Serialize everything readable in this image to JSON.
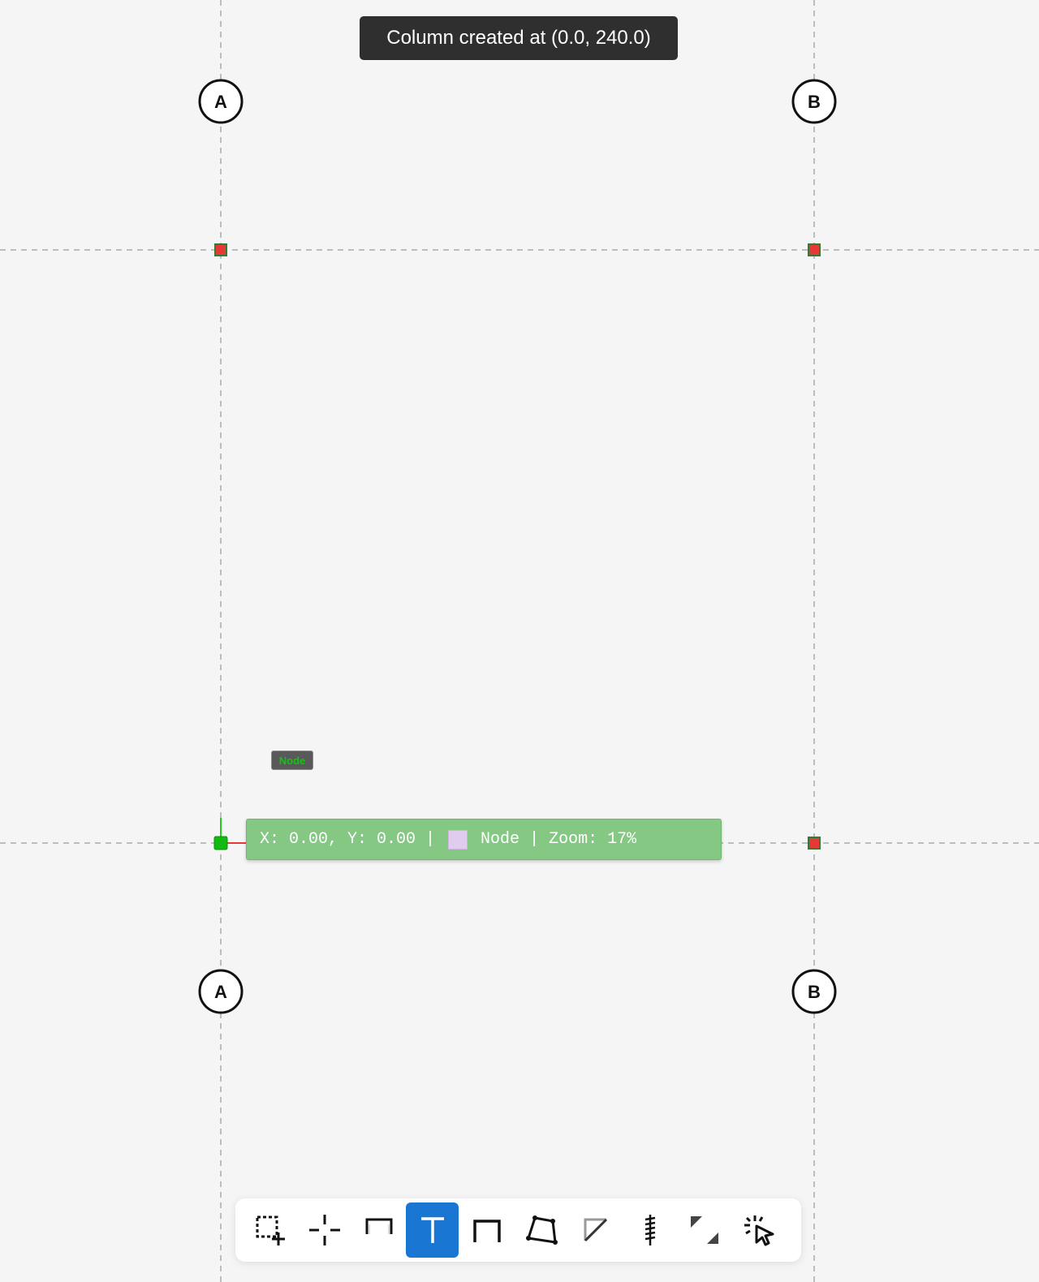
{
  "toast": {
    "message": "Column created at (0.0, 240.0)"
  },
  "node_tag": {
    "label": "Node"
  },
  "status": {
    "coords": "X: 0.00, Y: 0.00 |",
    "mode": "Node",
    "zoom": "| Zoom: 17%"
  },
  "grid": {
    "bubbles": [
      "A",
      "B",
      "A",
      "B"
    ]
  },
  "colors": {
    "canvas_bg": "#f5f5f5",
    "gridline": "#bdbdbd",
    "node_fill": "#e53935",
    "node_border": "#2e7d32",
    "active_tool": "#1976d2",
    "status_bg": "#84c884"
  },
  "toolbar": {
    "tools": [
      {
        "name": "select-area-icon",
        "active": false
      },
      {
        "name": "crosshair-node-icon",
        "active": false
      },
      {
        "name": "beam-icon",
        "active": false
      },
      {
        "name": "column-t-icon",
        "active": true
      },
      {
        "name": "frame-icon",
        "active": false
      },
      {
        "name": "polygon-icon",
        "active": false
      },
      {
        "name": "diagonal-brace-icon",
        "active": false
      },
      {
        "name": "spring-support-icon",
        "active": false
      },
      {
        "name": "resize-corners-icon",
        "active": false
      },
      {
        "name": "click-pointer-icon",
        "active": false
      }
    ]
  }
}
